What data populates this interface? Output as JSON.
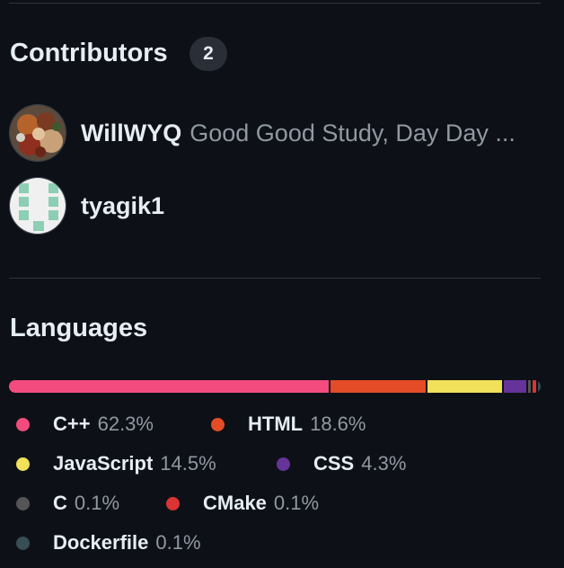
{
  "contributors": {
    "heading": "Contributors",
    "count": "2",
    "list": [
      {
        "login": "WillWYQ",
        "name": "Good Good Study, Day Day ..."
      },
      {
        "login": "tyagik1",
        "name": ""
      }
    ]
  },
  "languages": {
    "heading": "Languages",
    "items": [
      {
        "name": "C++",
        "percent": "62.3%",
        "value": 62.3,
        "color": "#f34b7d"
      },
      {
        "name": "HTML",
        "percent": "18.6%",
        "value": 18.6,
        "color": "#e34c26"
      },
      {
        "name": "JavaScript",
        "percent": "14.5%",
        "value": 14.5,
        "color": "#f1e05a"
      },
      {
        "name": "CSS",
        "percent": "4.3%",
        "value": 4.3,
        "color": "#663399"
      },
      {
        "name": "C",
        "percent": "0.1%",
        "value": 0.1,
        "color": "#555555"
      },
      {
        "name": "CMake",
        "percent": "0.1%",
        "value": 0.1,
        "color": "#da3434"
      },
      {
        "name": "Dockerfile",
        "percent": "0.1%",
        "value": 0.1,
        "color": "#384d54"
      }
    ]
  }
}
